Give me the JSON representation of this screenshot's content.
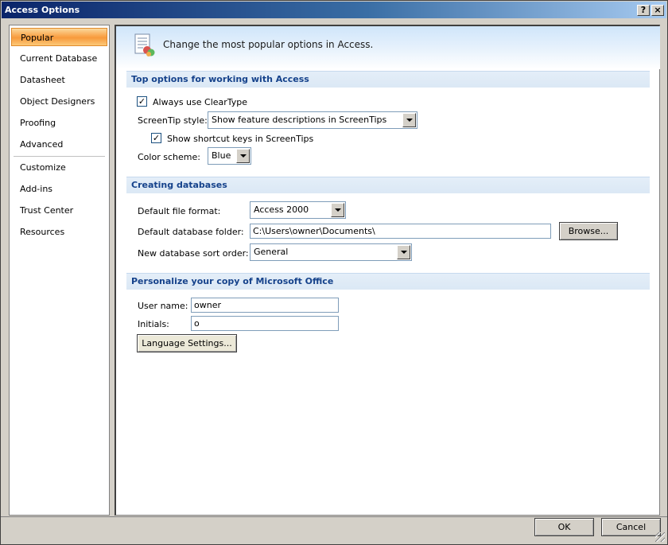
{
  "window": {
    "title": "Access Options",
    "help_label": "?",
    "close_label": "×"
  },
  "sidebar": {
    "items": [
      {
        "label": "Popular"
      },
      {
        "label": "Current Database"
      },
      {
        "label": "Datasheet"
      },
      {
        "label": "Object Designers"
      },
      {
        "label": "Proofing"
      },
      {
        "label": "Advanced"
      },
      {
        "label": "Customize"
      },
      {
        "label": "Add-ins"
      },
      {
        "label": "Trust Center"
      },
      {
        "label": "Resources"
      }
    ],
    "active_index": 0
  },
  "banner": {
    "text": "Change the most popular options in Access."
  },
  "sections": {
    "top_options": {
      "heading": "Top options for working with Access",
      "cleartype_label": "Always use ClearType",
      "cleartype_checked": true,
      "screentip_label": "ScreenTip style:",
      "screentip_value": "Show feature descriptions in ScreenTips",
      "shortcut_label": "Show shortcut keys in ScreenTips",
      "shortcut_checked": true,
      "color_scheme_label": "Color scheme:",
      "color_scheme_value": "Blue"
    },
    "creating": {
      "heading": "Creating databases",
      "file_format_label": "Default file format:",
      "file_format_value": "Access 2000",
      "folder_label": "Default database folder:",
      "folder_value": "C:\\Users\\owner\\Documents\\",
      "browse_label": "Browse...",
      "sort_order_label": "New database sort order:",
      "sort_order_value": "General"
    },
    "personalize": {
      "heading": "Personalize your copy of Microsoft Office",
      "username_label": "User name:",
      "username_value": "owner",
      "initials_label": "Initials:",
      "initials_value": "o",
      "language_button": "Language Settings..."
    }
  },
  "footer": {
    "ok_label": "OK",
    "cancel_label": "Cancel"
  },
  "colors": {
    "section_heading": "#15428b",
    "active_item": "#f79a3c",
    "title_bar": "#0a246a"
  }
}
